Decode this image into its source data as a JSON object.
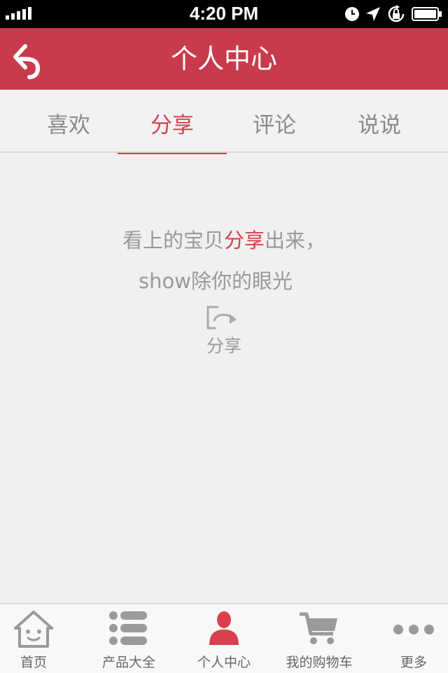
{
  "status_bar": {
    "time": "4:20 PM"
  },
  "nav": {
    "title": "个人中心",
    "back_icon": "back-arrow-icon"
  },
  "tabs": [
    {
      "label": "喜欢",
      "active": false
    },
    {
      "label": "分享",
      "active": true
    },
    {
      "label": "评论",
      "active": false
    },
    {
      "label": "说说",
      "active": false
    }
  ],
  "empty_state": {
    "line1_before": "看上的宝贝",
    "line1_highlight": "分享",
    "line1_after": "出来，",
    "line2": "show除你的眼光",
    "share_label": "分享",
    "share_icon": "share-icon"
  },
  "bottom_nav": [
    {
      "label": "首页",
      "icon": "home-icon"
    },
    {
      "label": "产品大全",
      "icon": "list-icon"
    },
    {
      "label": "个人中心",
      "icon": "person-icon",
      "active": true
    },
    {
      "label": "我的购物车",
      "icon": "cart-icon"
    },
    {
      "label": "更多",
      "icon": "more-icon"
    }
  ],
  "colors": {
    "nav_bg": "#c83a4c",
    "accent": "#d8404e",
    "page_bg": "#f0f0f0",
    "muted_text": "#999999"
  }
}
